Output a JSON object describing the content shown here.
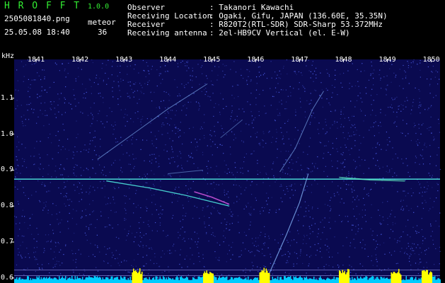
{
  "app": {
    "logo": "H R O F F T",
    "version": "1.0.0",
    "file_name": "2505081840.png",
    "timestamp": "25.05.08 18:40",
    "counter_label": "meteor",
    "counter_value": "36"
  },
  "info": {
    "labels": [
      "Observer",
      "Receiving Location",
      "Receiver",
      "Receiving antenna"
    ],
    "values": [
      ": Takanori Kawachi",
      ": Ogaki, Gifu, JAPAN (136.60E, 35.35N)",
      ": R820T2(RTL-SDR) SDR-Sharp 53.372MHz",
      ": 2el-HB9CV Vertical (el. E-W)"
    ]
  },
  "chart_data": {
    "type": "heatmap",
    "y_unit_label": "kHz",
    "x_ticks": [
      "1841",
      "1842",
      "1843",
      "1844",
      "1845",
      "1846",
      "1847",
      "1848",
      "1849",
      "1850"
    ],
    "y_ticks": [
      "1.1",
      "1.0",
      "0.9",
      "0.8",
      "0.7",
      "0.6"
    ],
    "x_range": [
      1840.5,
      1850.2
    ],
    "y_range": [
      0.59,
      1.2
    ],
    "carrier_khz": 0.875,
    "colors": {
      "background": "#0a0a50",
      "carrier": "#55ffee",
      "trail": "#88bbff",
      "meteor_bright": "#ff66ff",
      "level_bar": "#00ccff",
      "level_peak": "#ffff00",
      "ref_line": "#aaaaff"
    }
  }
}
